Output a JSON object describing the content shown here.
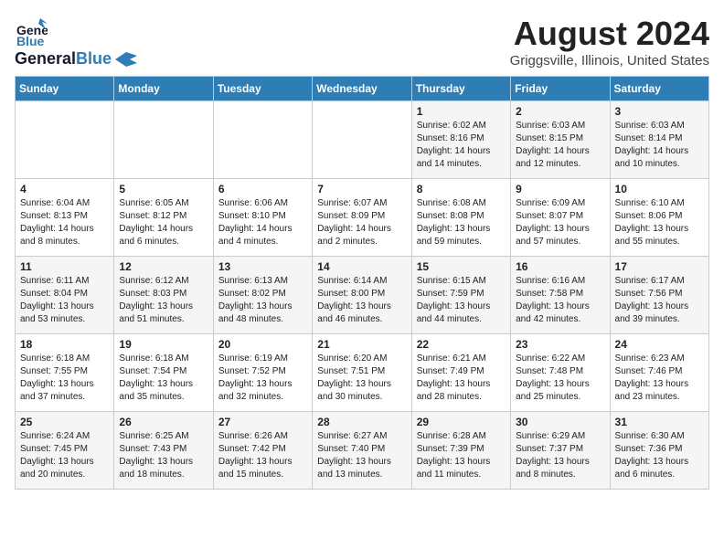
{
  "logo": {
    "general": "General",
    "blue": "Blue"
  },
  "title": "August 2024",
  "subtitle": "Griggsville, Illinois, United States",
  "days_of_week": [
    "Sunday",
    "Monday",
    "Tuesday",
    "Wednesday",
    "Thursday",
    "Friday",
    "Saturday"
  ],
  "weeks": [
    [
      {
        "day": "",
        "content": ""
      },
      {
        "day": "",
        "content": ""
      },
      {
        "day": "",
        "content": ""
      },
      {
        "day": "",
        "content": ""
      },
      {
        "day": "1",
        "content": "Sunrise: 6:02 AM\nSunset: 8:16 PM\nDaylight: 14 hours\nand 14 minutes."
      },
      {
        "day": "2",
        "content": "Sunrise: 6:03 AM\nSunset: 8:15 PM\nDaylight: 14 hours\nand 12 minutes."
      },
      {
        "day": "3",
        "content": "Sunrise: 6:03 AM\nSunset: 8:14 PM\nDaylight: 14 hours\nand 10 minutes."
      }
    ],
    [
      {
        "day": "4",
        "content": "Sunrise: 6:04 AM\nSunset: 8:13 PM\nDaylight: 14 hours\nand 8 minutes."
      },
      {
        "day": "5",
        "content": "Sunrise: 6:05 AM\nSunset: 8:12 PM\nDaylight: 14 hours\nand 6 minutes."
      },
      {
        "day": "6",
        "content": "Sunrise: 6:06 AM\nSunset: 8:10 PM\nDaylight: 14 hours\nand 4 minutes."
      },
      {
        "day": "7",
        "content": "Sunrise: 6:07 AM\nSunset: 8:09 PM\nDaylight: 14 hours\nand 2 minutes."
      },
      {
        "day": "8",
        "content": "Sunrise: 6:08 AM\nSunset: 8:08 PM\nDaylight: 13 hours\nand 59 minutes."
      },
      {
        "day": "9",
        "content": "Sunrise: 6:09 AM\nSunset: 8:07 PM\nDaylight: 13 hours\nand 57 minutes."
      },
      {
        "day": "10",
        "content": "Sunrise: 6:10 AM\nSunset: 8:06 PM\nDaylight: 13 hours\nand 55 minutes."
      }
    ],
    [
      {
        "day": "11",
        "content": "Sunrise: 6:11 AM\nSunset: 8:04 PM\nDaylight: 13 hours\nand 53 minutes."
      },
      {
        "day": "12",
        "content": "Sunrise: 6:12 AM\nSunset: 8:03 PM\nDaylight: 13 hours\nand 51 minutes."
      },
      {
        "day": "13",
        "content": "Sunrise: 6:13 AM\nSunset: 8:02 PM\nDaylight: 13 hours\nand 48 minutes."
      },
      {
        "day": "14",
        "content": "Sunrise: 6:14 AM\nSunset: 8:00 PM\nDaylight: 13 hours\nand 46 minutes."
      },
      {
        "day": "15",
        "content": "Sunrise: 6:15 AM\nSunset: 7:59 PM\nDaylight: 13 hours\nand 44 minutes."
      },
      {
        "day": "16",
        "content": "Sunrise: 6:16 AM\nSunset: 7:58 PM\nDaylight: 13 hours\nand 42 minutes."
      },
      {
        "day": "17",
        "content": "Sunrise: 6:17 AM\nSunset: 7:56 PM\nDaylight: 13 hours\nand 39 minutes."
      }
    ],
    [
      {
        "day": "18",
        "content": "Sunrise: 6:18 AM\nSunset: 7:55 PM\nDaylight: 13 hours\nand 37 minutes."
      },
      {
        "day": "19",
        "content": "Sunrise: 6:18 AM\nSunset: 7:54 PM\nDaylight: 13 hours\nand 35 minutes."
      },
      {
        "day": "20",
        "content": "Sunrise: 6:19 AM\nSunset: 7:52 PM\nDaylight: 13 hours\nand 32 minutes."
      },
      {
        "day": "21",
        "content": "Sunrise: 6:20 AM\nSunset: 7:51 PM\nDaylight: 13 hours\nand 30 minutes."
      },
      {
        "day": "22",
        "content": "Sunrise: 6:21 AM\nSunset: 7:49 PM\nDaylight: 13 hours\nand 28 minutes."
      },
      {
        "day": "23",
        "content": "Sunrise: 6:22 AM\nSunset: 7:48 PM\nDaylight: 13 hours\nand 25 minutes."
      },
      {
        "day": "24",
        "content": "Sunrise: 6:23 AM\nSunset: 7:46 PM\nDaylight: 13 hours\nand 23 minutes."
      }
    ],
    [
      {
        "day": "25",
        "content": "Sunrise: 6:24 AM\nSunset: 7:45 PM\nDaylight: 13 hours\nand 20 minutes."
      },
      {
        "day": "26",
        "content": "Sunrise: 6:25 AM\nSunset: 7:43 PM\nDaylight: 13 hours\nand 18 minutes."
      },
      {
        "day": "27",
        "content": "Sunrise: 6:26 AM\nSunset: 7:42 PM\nDaylight: 13 hours\nand 15 minutes."
      },
      {
        "day": "28",
        "content": "Sunrise: 6:27 AM\nSunset: 7:40 PM\nDaylight: 13 hours\nand 13 minutes."
      },
      {
        "day": "29",
        "content": "Sunrise: 6:28 AM\nSunset: 7:39 PM\nDaylight: 13 hours\nand 11 minutes."
      },
      {
        "day": "30",
        "content": "Sunrise: 6:29 AM\nSunset: 7:37 PM\nDaylight: 13 hours\nand 8 minutes."
      },
      {
        "day": "31",
        "content": "Sunrise: 6:30 AM\nSunset: 7:36 PM\nDaylight: 13 hours\nand 6 minutes."
      }
    ]
  ]
}
